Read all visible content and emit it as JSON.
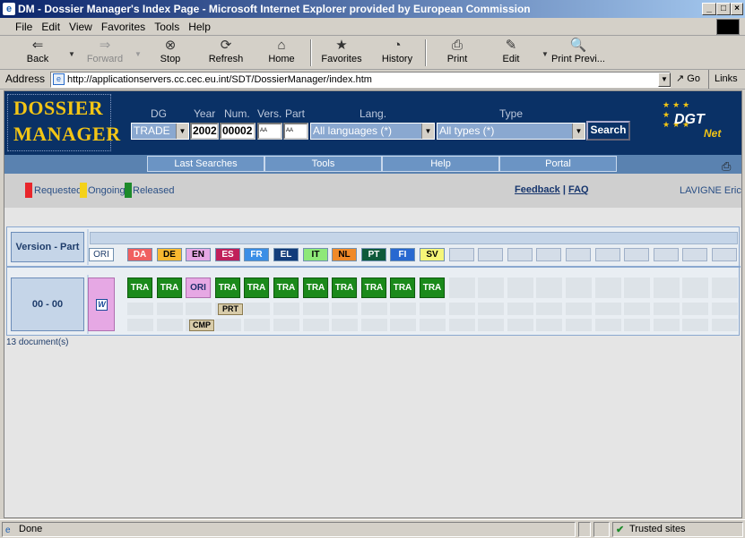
{
  "window": {
    "title": "DM - Dossier Manager's Index Page - Microsoft Internet Explorer provided by European Commission"
  },
  "menu": [
    "File",
    "Edit",
    "View",
    "Favorites",
    "Tools",
    "Help"
  ],
  "toolbar": {
    "back": "Back",
    "forward": "Forward",
    "stop": "Stop",
    "refresh": "Refresh",
    "home": "Home",
    "favorites": "Favorites",
    "history": "History",
    "print": "Print",
    "edit": "Edit",
    "print_preview": "Print Previ..."
  },
  "address": {
    "label": "Address",
    "url": "http://applicationservers.cc.cec.eu.int/SDT/DossierManager/index.htm",
    "go": "Go",
    "links": "Links"
  },
  "app": {
    "logo_line1": "DOSSIER",
    "logo_line2": "MANAGER",
    "brand": "DGT",
    "brand_sub": "Net",
    "fields": {
      "dg_label": "DG",
      "dg_value": "TRADE",
      "year_label": "Year",
      "year_value": "2002",
      "num_label": "Num.",
      "num_value": "00002",
      "vers_label": "Vers.",
      "vers_value": "AA",
      "part_label": "Part",
      "part_value": "AA",
      "lang_label": "Lang.",
      "lang_value": "All languages (*)",
      "type_label": "Type",
      "type_value": "All types (*)",
      "search": "Search"
    },
    "nav": [
      "Last Searches",
      "Tools",
      "Help",
      "Portal"
    ],
    "legend": [
      {
        "label": "Requested",
        "color": "#e8262b"
      },
      {
        "label": "Ongoing",
        "color": "#f4d21a"
      },
      {
        "label": "Released",
        "color": "#1d8a2a"
      }
    ],
    "feedback": "Feedback",
    "faq": "FAQ",
    "sep": "|",
    "user": "LAVIGNE Eric"
  },
  "grid": {
    "version_part_header": "Version - Part",
    "ori_label": "ORI",
    "languages": [
      {
        "code": "DA",
        "bg": "#f06060",
        "fg": "#ffffff"
      },
      {
        "code": "DE",
        "bg": "#f8b830",
        "fg": "#000000"
      },
      {
        "code": "EN",
        "bg": "#e6a8e4",
        "fg": "#000000"
      },
      {
        "code": "ES",
        "bg": "#c0205a",
        "fg": "#ffffff"
      },
      {
        "code": "FR",
        "bg": "#3a8ee6",
        "fg": "#ffffff"
      },
      {
        "code": "EL",
        "bg": "#123c7a",
        "fg": "#ffffff"
      },
      {
        "code": "IT",
        "bg": "#8ee878",
        "fg": "#000000"
      },
      {
        "code": "NL",
        "bg": "#f08a28",
        "fg": "#000000"
      },
      {
        "code": "PT",
        "bg": "#0e5a3a",
        "fg": "#ffffff"
      },
      {
        "code": "FI",
        "bg": "#2868d0",
        "fg": "#ffffff"
      },
      {
        "code": "SV",
        "bg": "#f6f678",
        "fg": "#000000"
      }
    ],
    "row": {
      "label": "00 - 00",
      "docs": [
        "TRA",
        "TRA",
        "ORI",
        "TRA",
        "TRA",
        "TRA",
        "TRA",
        "TRA",
        "TRA",
        "TRA",
        "TRA"
      ],
      "prt_label": "PRT",
      "cmp_label": "CMP"
    },
    "doc_count": "13 document(s)"
  },
  "status": {
    "text": "Done",
    "zone": "Trusted sites"
  }
}
